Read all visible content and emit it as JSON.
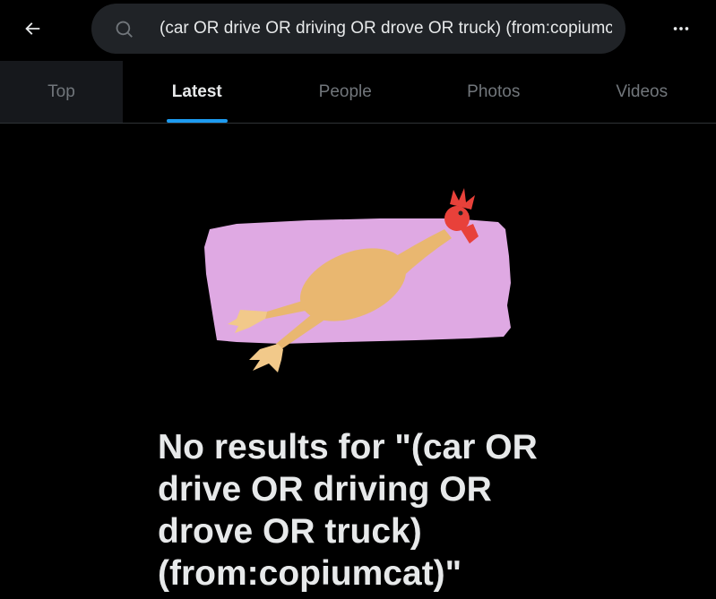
{
  "header": {
    "search_value": "(car OR drive OR driving OR drove OR truck) (from:copiumcat)",
    "back_icon": "arrow-left-icon",
    "search_icon": "search-icon",
    "more_icon": "more-horizontal-icon"
  },
  "tabs": [
    {
      "label": "Top",
      "active": false
    },
    {
      "label": "Latest",
      "active": true
    },
    {
      "label": "People",
      "active": false
    },
    {
      "label": "Photos",
      "active": false
    },
    {
      "label": "Videos",
      "active": false
    }
  ],
  "empty_state": {
    "title": "No results for \"(car OR drive OR driving OR drove OR truck) (from:copiumcat)\"",
    "illustration": "rubber-chicken-illustration"
  },
  "colors": {
    "background": "#000000",
    "accent": "#1d9bf0",
    "search_bg": "#202327",
    "illustration_bg": "#dfa9e3"
  }
}
